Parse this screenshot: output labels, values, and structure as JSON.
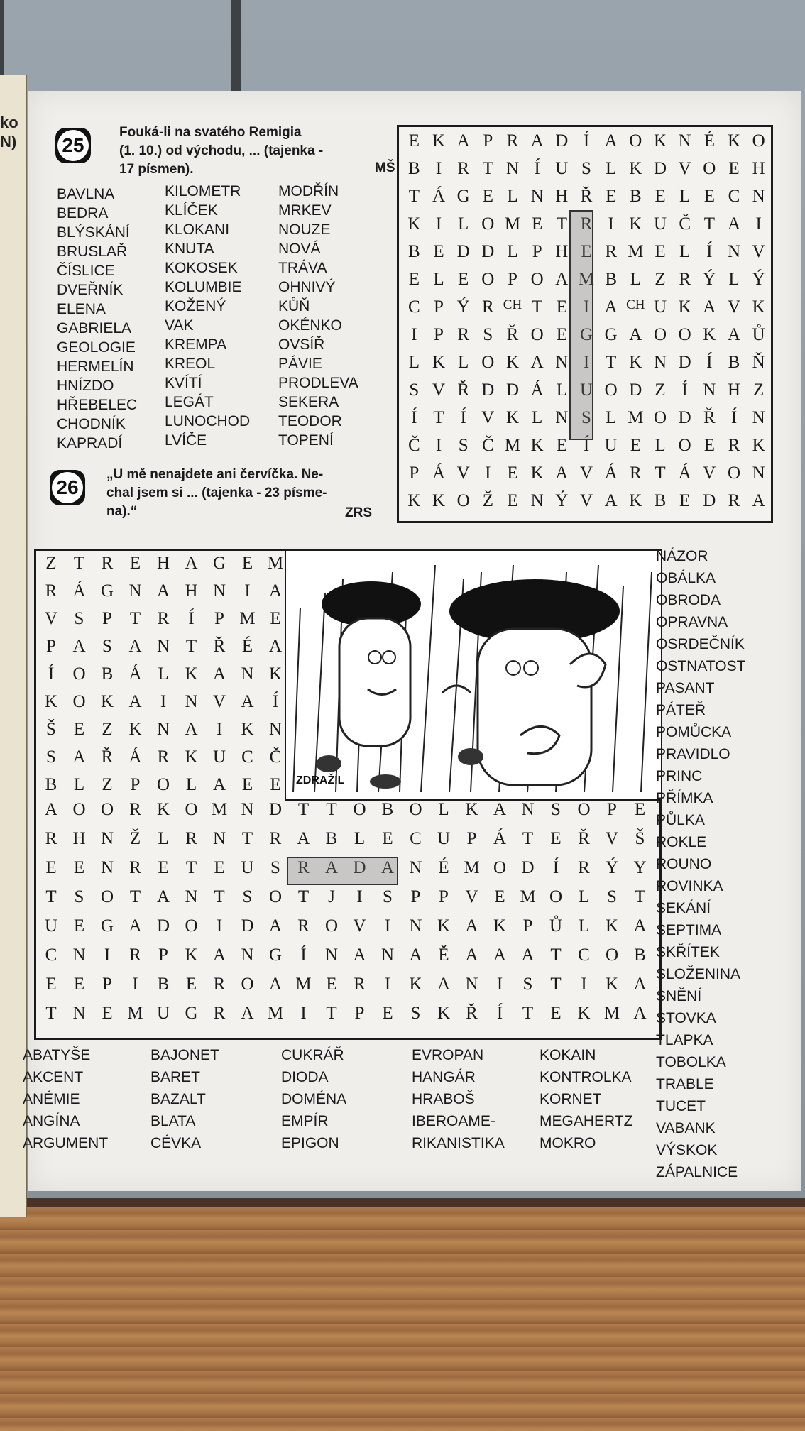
{
  "left_page_fragment": [
    "ko",
    "N)"
  ],
  "puzzle25": {
    "number": "25",
    "clue_lines": [
      "Fouká-li na svatého Remigia",
      "(1. 10.) od východu, ... (tajenka -",
      "17 písmen)."
    ],
    "author": "MŠ",
    "words_col1": [
      "BAVLNA",
      "BEDRA",
      "BLÝSKÁNÍ",
      "BRUSLAŘ",
      "ČÍSLICE",
      "DVEŘNÍK",
      "ELENA",
      "GABRIELA",
      "GEOLOGIE",
      "HERMELÍN",
      "HNÍZDO",
      "HŘEBELEC",
      "CHODNÍK",
      "KAPRADÍ"
    ],
    "words_col2": [
      "KILOMETR",
      "KLÍČEK",
      "KLOKANI",
      "KNUTA",
      "KOKOSEK",
      "KOLUMBIE",
      "KOŽENÝ",
      "VAK",
      "KREMPA",
      "KREOL",
      "KVÍTÍ",
      "LEGÁT",
      "LUNOCHOD",
      "LVÍČE"
    ],
    "words_col3": [
      "MODŘÍN",
      "MRKEV",
      "NOUZE",
      "NOVÁ",
      "TRÁVA",
      "OHNIVÝ",
      "KŮŇ",
      "OKÉNKO",
      "OVSÍŘ",
      "PÁVIE",
      "PRODLEVA",
      "SEKERA",
      "TEODOR",
      "TOPENÍ"
    ],
    "grid": [
      "EKAPRADÍAOKNÉKO",
      "BIRTNÍUSLKDVOEH",
      "TÁGELNHŘEBELECN",
      "KILOMETRIKUČTAI",
      "BEDDLPHERMELÍNV",
      "ELEOPOAMBLZRÝLÝ",
      "CPÝRCHTEIACHUKAVK",
      "IPRSŘOEGGAOOKAŮ",
      "LKLOKANITKNDÍBŇ",
      "SVŘDDÁLUODZÍNHZ",
      "ÍTÍVKLNSLMODŘÍN",
      "ČISČMKEÍUELOERK",
      "PÁVIEKAVÁRTÁVON",
      "KKOŽENÝVAKBEDRA"
    ]
  },
  "puzzle26": {
    "number": "26",
    "clue_lines": [
      "„U mě nenajdete ani červíčka. Ne-",
      "chal jsem si ... (tajenka - 23 písme-",
      "na).“"
    ],
    "author": "ZRS",
    "illustration_signature": "ZDRAŽIL",
    "grid_top": [
      "ZTREHAGEM",
      "RÁGNAHNIA",
      "VSPTRÍPME",
      "PASANTŘÉA",
      "ÍOBÁLKANK",
      "KOKAINVAÍ",
      "ŠEZKNAIKN",
      "SAŘÁRKUCČ",
      "BLZPOLAEE"
    ],
    "grid_full": [
      "AOORKOMNDTTOBOLKANSOPE",
      "RHNŽLRNTRABLECUPÁTEŘVŠ",
      "EENRETEUSRADANÉMODÍRÝY",
      "TSOTANTSOTJISPPVEMOLST",
      "UEGADOIDAROVINKAKPŮLKA",
      "CNIRPKANGÍNANAĚAAATCOB",
      "EEPIBEROAMERIKANISTIKA",
      "TNEMUGRAMITPESKŘÍTEKMA"
    ],
    "words_right": [
      "NÁZOR",
      "OBÁLKA",
      "OBRODA",
      "OPRAVNA",
      "OSRDEČNÍK",
      "OSTNATOST",
      "PASANT",
      "PÁTEŘ",
      "POMŮCKA",
      "PRAVIDLO",
      "PRINC",
      "PŘÍMKA",
      "PŮLKA",
      "ROKLE",
      "ROUNO",
      "ROVINKA",
      "SEKÁNÍ",
      "SEPTIMA",
      "SKŘÍTEK",
      "SLOŽENINA",
      "SNĚNÍ",
      "STOVKA",
      "TLAPKA",
      "TOBOLKA",
      "TRABLE",
      "TUCET",
      "VABANK",
      "VÝSKOK",
      "ZÁPALNICE"
    ],
    "words_bottom": [
      [
        "ABATYŠE",
        "AKCENT",
        "ANÉMIE",
        "ANGÍNA",
        "ARGUMENT"
      ],
      [
        "BAJONET",
        "BARET",
        "BAZALT",
        "BLATA",
        "CÉVKA"
      ],
      [
        "CUKRÁŘ",
        "DIODA",
        "DOMÉNA",
        "EMPÍR",
        "EPIGON"
      ],
      [
        "EVROPAN",
        "HANGÁR",
        "HRABOŠ",
        "IBEROAME-",
        "RIKANISTIKA"
      ],
      [
        "KOKAIN",
        "KONTROLKA",
        "KORNET",
        "MEGAHERTZ",
        "MOKRO"
      ]
    ]
  }
}
